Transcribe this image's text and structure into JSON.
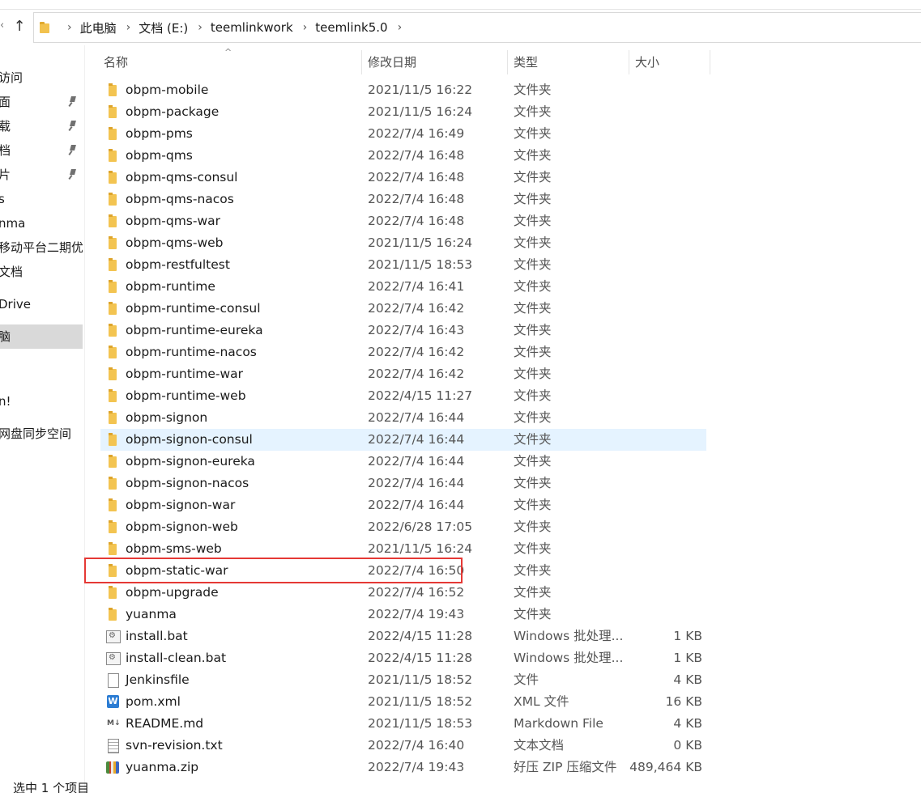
{
  "breadcrumb": [
    "此电脑",
    "文档 (E:)",
    "teemlinkwork",
    "teemlink5.0"
  ],
  "sidebar": {
    "items": [
      {
        "label": "访问"
      },
      {
        "label": "面"
      },
      {
        "label": "载"
      },
      {
        "label": "档"
      },
      {
        "label": "片"
      },
      {
        "label": "s"
      },
      {
        "label": "nma"
      },
      {
        "label": "移动平台二期优"
      },
      {
        "label": "文档"
      },
      {
        "label": "Drive"
      },
      {
        "label": "脑"
      },
      {
        "label": "n!"
      },
      {
        "label": "网盘同步空间"
      }
    ]
  },
  "columns": {
    "name": "名称",
    "date": "修改日期",
    "type": "类型",
    "size": "大小"
  },
  "files": [
    {
      "name": "obpm-mobile",
      "date": "2021/11/5 16:22",
      "type": "文件夹",
      "size": "",
      "icon": "folder-icon"
    },
    {
      "name": "obpm-package",
      "date": "2021/11/5 16:24",
      "type": "文件夹",
      "size": "",
      "icon": "folder-icon"
    },
    {
      "name": "obpm-pms",
      "date": "2022/7/4 16:49",
      "type": "文件夹",
      "size": "",
      "icon": "folder-icon"
    },
    {
      "name": "obpm-qms",
      "date": "2022/7/4 16:48",
      "type": "文件夹",
      "size": "",
      "icon": "folder-icon"
    },
    {
      "name": "obpm-qms-consul",
      "date": "2022/7/4 16:48",
      "type": "文件夹",
      "size": "",
      "icon": "folder-icon"
    },
    {
      "name": "obpm-qms-nacos",
      "date": "2022/7/4 16:48",
      "type": "文件夹",
      "size": "",
      "icon": "folder-icon"
    },
    {
      "name": "obpm-qms-war",
      "date": "2022/7/4 16:48",
      "type": "文件夹",
      "size": "",
      "icon": "folder-icon"
    },
    {
      "name": "obpm-qms-web",
      "date": "2021/11/5 16:24",
      "type": "文件夹",
      "size": "",
      "icon": "folder-icon"
    },
    {
      "name": "obpm-restfultest",
      "date": "2021/11/5 18:53",
      "type": "文件夹",
      "size": "",
      "icon": "folder-icon"
    },
    {
      "name": "obpm-runtime",
      "date": "2022/7/4 16:41",
      "type": "文件夹",
      "size": "",
      "icon": "folder-icon"
    },
    {
      "name": "obpm-runtime-consul",
      "date": "2022/7/4 16:42",
      "type": "文件夹",
      "size": "",
      "icon": "folder-icon"
    },
    {
      "name": "obpm-runtime-eureka",
      "date": "2022/7/4 16:43",
      "type": "文件夹",
      "size": "",
      "icon": "folder-icon"
    },
    {
      "name": "obpm-runtime-nacos",
      "date": "2022/7/4 16:42",
      "type": "文件夹",
      "size": "",
      "icon": "folder-icon"
    },
    {
      "name": "obpm-runtime-war",
      "date": "2022/7/4 16:42",
      "type": "文件夹",
      "size": "",
      "icon": "folder-icon"
    },
    {
      "name": "obpm-runtime-web",
      "date": "2022/4/15 11:27",
      "type": "文件夹",
      "size": "",
      "icon": "folder-icon"
    },
    {
      "name": "obpm-signon",
      "date": "2022/7/4 16:44",
      "type": "文件夹",
      "size": "",
      "icon": "folder-icon"
    },
    {
      "name": "obpm-signon-consul",
      "date": "2022/7/4 16:44",
      "type": "文件夹",
      "size": "",
      "icon": "folder-icon"
    },
    {
      "name": "obpm-signon-eureka",
      "date": "2022/7/4 16:44",
      "type": "文件夹",
      "size": "",
      "icon": "folder-icon"
    },
    {
      "name": "obpm-signon-nacos",
      "date": "2022/7/4 16:44",
      "type": "文件夹",
      "size": "",
      "icon": "folder-icon"
    },
    {
      "name": "obpm-signon-war",
      "date": "2022/7/4 16:44",
      "type": "文件夹",
      "size": "",
      "icon": "folder-icon"
    },
    {
      "name": "obpm-signon-web",
      "date": "2022/6/28 17:05",
      "type": "文件夹",
      "size": "",
      "icon": "folder-icon"
    },
    {
      "name": "obpm-sms-web",
      "date": "2021/11/5 16:24",
      "type": "文件夹",
      "size": "",
      "icon": "folder-icon"
    },
    {
      "name": "obpm-static-war",
      "date": "2022/7/4 16:50",
      "type": "文件夹",
      "size": "",
      "icon": "folder-icon"
    },
    {
      "name": "obpm-upgrade",
      "date": "2022/7/4 16:52",
      "type": "文件夹",
      "size": "",
      "icon": "folder-icon"
    },
    {
      "name": "yuanma",
      "date": "2022/7/4 19:43",
      "type": "文件夹",
      "size": "",
      "icon": "folder-icon"
    },
    {
      "name": "install.bat",
      "date": "2022/4/15 11:28",
      "type": "Windows 批处理...",
      "size": "1 KB",
      "icon": "batch-file-icon"
    },
    {
      "name": "install-clean.bat",
      "date": "2022/4/15 11:28",
      "type": "Windows 批处理...",
      "size": "1 KB",
      "icon": "batch-file-icon"
    },
    {
      "name": "Jenkinsfile",
      "date": "2021/11/5 18:52",
      "type": "文件",
      "size": "4 KB",
      "icon": "blank-file-icon"
    },
    {
      "name": "pom.xml",
      "date": "2021/11/5 18:52",
      "type": "XML 文件",
      "size": "16 KB",
      "icon": "xml-file-icon"
    },
    {
      "name": "README.md",
      "date": "2021/11/5 18:53",
      "type": "Markdown File",
      "size": "4 KB",
      "icon": "markdown-file-icon"
    },
    {
      "name": "svn-revision.txt",
      "date": "2022/7/4 16:40",
      "type": "文本文档",
      "size": "0 KB",
      "icon": "text-file-icon"
    },
    {
      "name": "yuanma.zip",
      "date": "2022/7/4 19:43",
      "type": "好压 ZIP 压缩文件",
      "size": "489,464 KB",
      "icon": "zip-archive-icon"
    }
  ],
  "status": {
    "selection": "选中 1 个项目"
  }
}
